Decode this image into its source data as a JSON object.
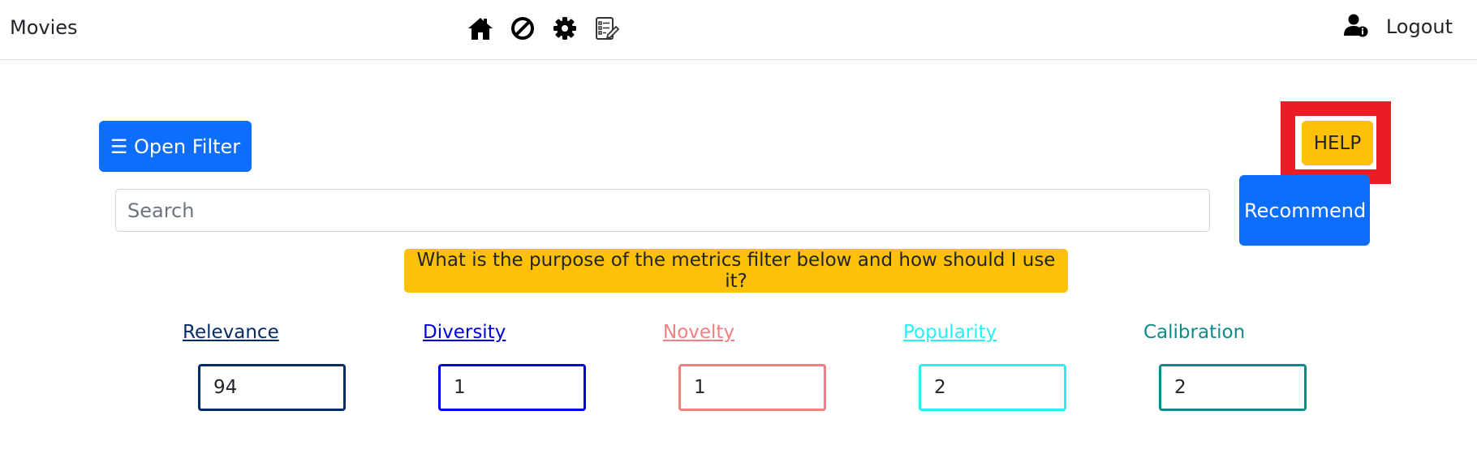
{
  "navbar": {
    "brand": "Movies",
    "icons": [
      "home-icon",
      "ban-icon",
      "gear-icon",
      "checklist-edit-icon"
    ],
    "user_icon": "user-info-icon",
    "logout_label": "Logout"
  },
  "filter": {
    "open_label": "☰ Open Filter"
  },
  "help": {
    "label": "HELP",
    "highlight_color": "#ec1c24"
  },
  "search": {
    "placeholder": "Search",
    "value": ""
  },
  "recommend": {
    "label": "Recommend"
  },
  "question": {
    "label": "What is the purpose of the metrics filter below and how should I use it?"
  },
  "metrics": [
    {
      "label": "Relevance",
      "value": "94",
      "color": "#052c65",
      "underlined": true
    },
    {
      "label": "Diversity",
      "value": "1",
      "color": "#0000e6",
      "underlined": true
    },
    {
      "label": "Novelty",
      "value": "1",
      "color": "#f08080",
      "underlined": true
    },
    {
      "label": "Popularity",
      "value": "2",
      "color": "#26f0f0",
      "underlined": true
    },
    {
      "label": "Calibration",
      "value": "2",
      "color": "#0f8a8a",
      "underlined": false
    }
  ],
  "colors": {
    "primary": "#0d6efd",
    "warning": "#ffc107"
  }
}
